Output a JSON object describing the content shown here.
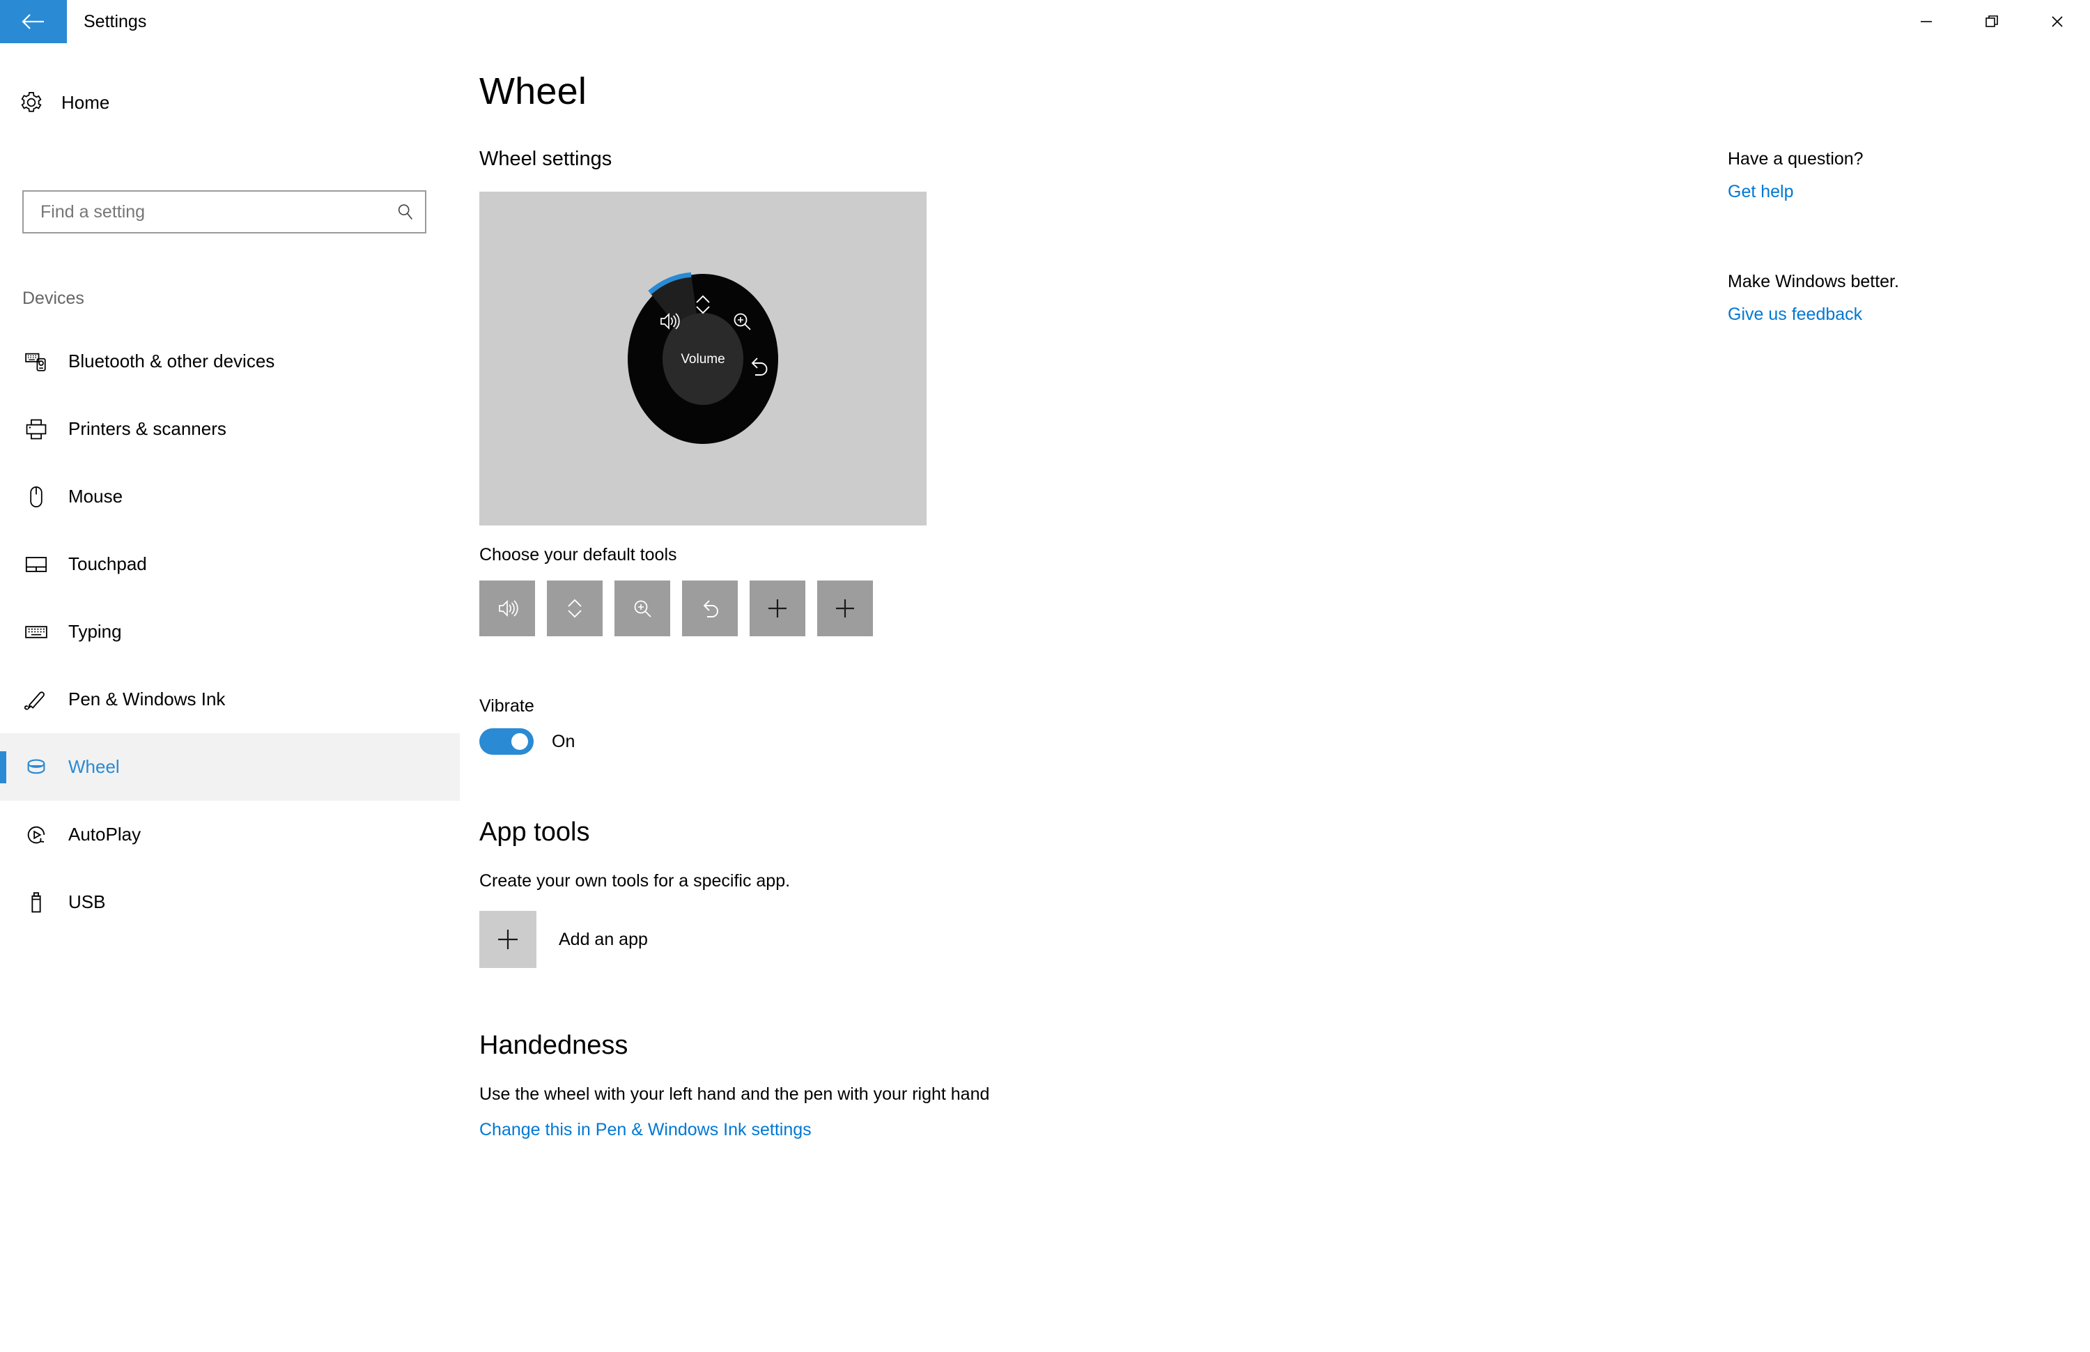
{
  "titlebar": {
    "app_title": "Settings",
    "back_icon": "back-arrow-icon",
    "minimize_label": "Minimize",
    "restore_label": "Restore",
    "close_label": "Close"
  },
  "sidebar": {
    "home_label": "Home",
    "home_icon": "gear-icon",
    "search": {
      "placeholder": "Find a setting",
      "value": "",
      "icon": "search-icon"
    },
    "group_label": "Devices",
    "items": [
      {
        "label": "Bluetooth & other devices",
        "icon": "bluetooth-devices-icon",
        "selected": false
      },
      {
        "label": "Printers & scanners",
        "icon": "printer-icon",
        "selected": false
      },
      {
        "label": "Mouse",
        "icon": "mouse-icon",
        "selected": false
      },
      {
        "label": "Touchpad",
        "icon": "touchpad-icon",
        "selected": false
      },
      {
        "label": "Typing",
        "icon": "keyboard-icon",
        "selected": false
      },
      {
        "label": "Pen & Windows Ink",
        "icon": "pen-icon",
        "selected": false
      },
      {
        "label": "Wheel",
        "icon": "wheel-icon",
        "selected": true
      },
      {
        "label": "AutoPlay",
        "icon": "autoplay-icon",
        "selected": false
      },
      {
        "label": "USB",
        "icon": "usb-icon",
        "selected": false
      }
    ]
  },
  "main": {
    "page_title": "Wheel",
    "wheel_settings_heading": "Wheel settings",
    "wheel_preview": {
      "center_label": "Volume",
      "sectors": [
        {
          "name": "volume",
          "icon": "volume-icon",
          "highlighted": true
        },
        {
          "name": "scroll",
          "icon": "scroll-updown-icon",
          "highlighted": false
        },
        {
          "name": "zoom",
          "icon": "zoom-in-icon",
          "highlighted": false
        },
        {
          "name": "undo",
          "icon": "undo-icon",
          "highlighted": false
        }
      ]
    },
    "default_tools_label": "Choose your default tools",
    "default_tools": [
      {
        "icon": "volume-icon",
        "kind": "tool"
      },
      {
        "icon": "scroll-updown-icon",
        "kind": "tool"
      },
      {
        "icon": "zoom-in-icon",
        "kind": "tool"
      },
      {
        "icon": "undo-icon",
        "kind": "tool"
      },
      {
        "icon": "plus-icon",
        "kind": "add"
      },
      {
        "icon": "plus-icon",
        "kind": "add"
      }
    ],
    "vibrate_label": "Vibrate",
    "vibrate_state": "On",
    "vibrate_on": true,
    "app_tools_heading": "App tools",
    "app_tools_description": "Create your own tools for a specific app.",
    "add_app_label": "Add an app",
    "add_app_icon": "plus-icon",
    "handedness_heading": "Handedness",
    "handedness_description": "Use the wheel with your left hand and the pen with your right hand",
    "handedness_link": "Change this in Pen & Windows Ink settings"
  },
  "rail": {
    "question_heading": "Have a question?",
    "get_help_label": "Get help",
    "feedback_heading": "Make Windows better.",
    "feedback_label": "Give us feedback"
  },
  "colors": {
    "accent": "#2a8ad4",
    "link": "#0078d4",
    "preview_bg": "#cccccc",
    "tool_tile": "#9d9d9d",
    "wheel_body": "#050505",
    "wheel_highlight": "#1f1f1f",
    "wheel_hub": "#2a2a2a"
  }
}
